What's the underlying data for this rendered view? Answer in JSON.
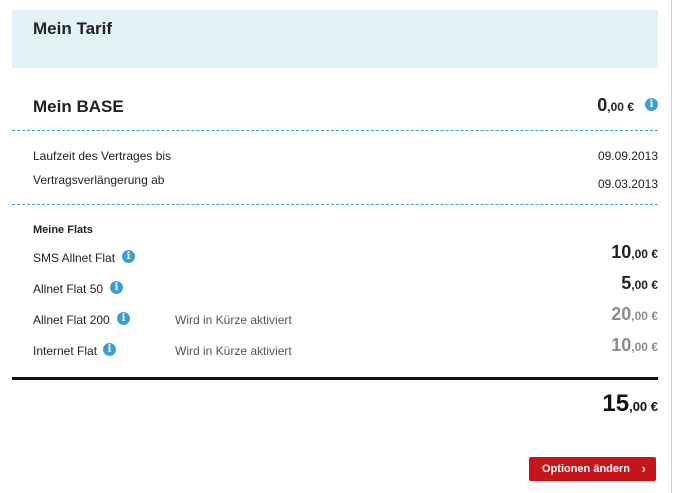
{
  "header": {
    "title": "Mein Tarif"
  },
  "plan": {
    "name": "Mein BASE",
    "price_main": "0",
    "price_fraction": ",00 €"
  },
  "contract": {
    "rows": [
      {
        "label": "Laufzeit des Vertrages bis",
        "value": "09.09.2013"
      },
      {
        "label": "Vertragsverlängerung ab",
        "value": "09.03.2013"
      }
    ]
  },
  "flats": {
    "heading": "Meine Flats",
    "items": [
      {
        "label": "SMS Allnet Flat",
        "status": "",
        "price_main": "10",
        "price_fraction": ",00 €",
        "active": true
      },
      {
        "label": "Allnet Flat 50",
        "status": "",
        "price_main": "5",
        "price_fraction": ",00 €",
        "active": true
      },
      {
        "label": "Allnet Flat 200",
        "status": "Wird in Kürze aktiviert",
        "price_main": "20",
        "price_fraction": ",00 €",
        "active": false
      },
      {
        "label": "Internet Flat",
        "status": "Wird in Kürze aktiviert",
        "price_main": "10",
        "price_fraction": ",00 €",
        "active": false
      }
    ]
  },
  "total": {
    "main": "15",
    "fraction": ",00 €"
  },
  "actions": {
    "options_button_label": "Optionen ändern",
    "chevron": "›"
  },
  "icons": {
    "info": "i"
  },
  "colors": {
    "accent_blue": "#3d9fd1",
    "header_bg": "#e3f1f8",
    "button_red": "#c6141b",
    "pending_grey": "#8c8c8c"
  }
}
